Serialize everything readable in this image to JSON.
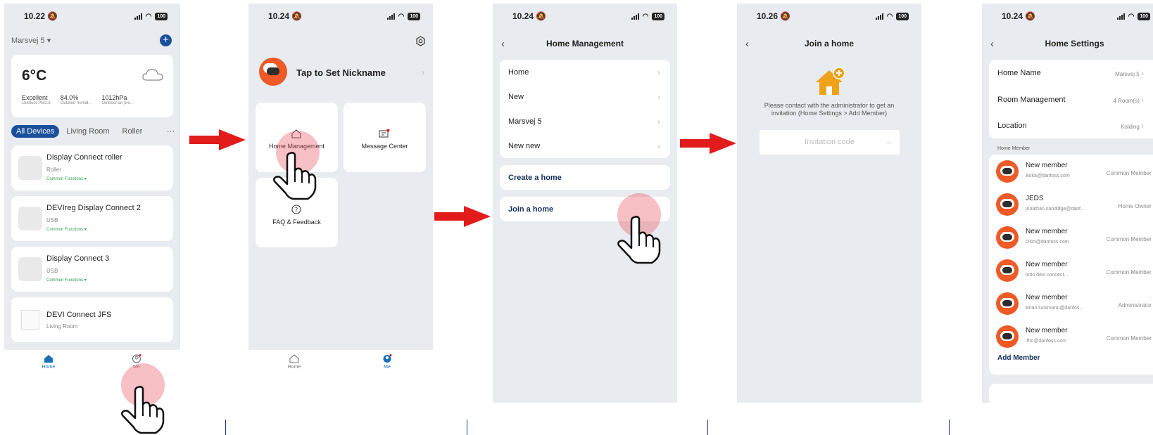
{
  "colors": {
    "accent": "#1a6fb5",
    "brand": "#ef5a26",
    "arrow": "#e21b1b",
    "link": "#14305f",
    "green": "#2a9d4a",
    "home_icon": "#f0a21b"
  },
  "screen1": {
    "time": "10.22",
    "battery": "100",
    "home_selector": "Marsvej 5",
    "weather": {
      "temp": "6°C",
      "icon": "cloud-icon",
      "stats": [
        {
          "value": "Excellent",
          "label": "Outdoor PM2.5"
        },
        {
          "value": "84.0%",
          "label": "Outdoor humid..."
        },
        {
          "value": "1012hPa",
          "label": "Outdoor air pre..."
        }
      ]
    },
    "filters": [
      "All Devices",
      "Living Room",
      "Roller"
    ],
    "devices": [
      {
        "name": "Display Connect roller",
        "sub": "Roller",
        "extra": "Common Functions"
      },
      {
        "name": "DEVIreg Display Connect 2",
        "sub": "USB",
        "extra": "Common Functions"
      },
      {
        "name": "Display Connect 3",
        "sub": "USB",
        "extra": "Common Functions"
      },
      {
        "name": "DEVI Connect JFS",
        "sub": "Living Room",
        "extra": ""
      }
    ],
    "tabs": {
      "home": "Home",
      "me": "Me"
    }
  },
  "screen2": {
    "time": "10.24",
    "battery": "100",
    "nickname": "Tap to Set Nickname",
    "tiles": [
      "Home Management",
      "Message Center",
      "FAQ & Feedback"
    ],
    "tabs": {
      "home": "Home",
      "me": "Me"
    }
  },
  "screen3": {
    "time": "10.24",
    "battery": "100",
    "title": "Home Management",
    "homes": [
      "Home",
      "New",
      "Marsvej 5",
      "New new"
    ],
    "create": "Create a home",
    "join": "Join a home"
  },
  "screen4": {
    "time": "10.26",
    "battery": "100",
    "title": "Join a home",
    "message": "Please contact with the administrator to get an invitation (Home Settings > Add Member)",
    "placeholder": "Invitation code"
  },
  "screen5": {
    "time": "10.24",
    "battery": "100",
    "title": "Home Settings",
    "settings": [
      {
        "label": "Home Name",
        "value": "Marsvej 5"
      },
      {
        "label": "Room Management",
        "value": "4 Room(s)"
      },
      {
        "label": "Location",
        "value": "Kolding"
      }
    ],
    "section": "Home Member",
    "members": [
      {
        "name": "New member",
        "email": "Boka@danfoss.com",
        "role": "Common Member"
      },
      {
        "name": "JEDS",
        "email": "jonathan.sandidge@danf...",
        "role": "Home Owner"
      },
      {
        "name": "New member",
        "email": "Okm@danfoss.com",
        "role": "Common Member"
      },
      {
        "name": "New member",
        "email": "lotto.devi.connect...",
        "role": "Common Member"
      },
      {
        "name": "New member",
        "email": "Brian.luckmann@danfos...",
        "role": "Administrator"
      },
      {
        "name": "New member",
        "email": "Jho@danfoss.com",
        "role": "Common Member"
      }
    ],
    "add_member": "Add Member"
  }
}
